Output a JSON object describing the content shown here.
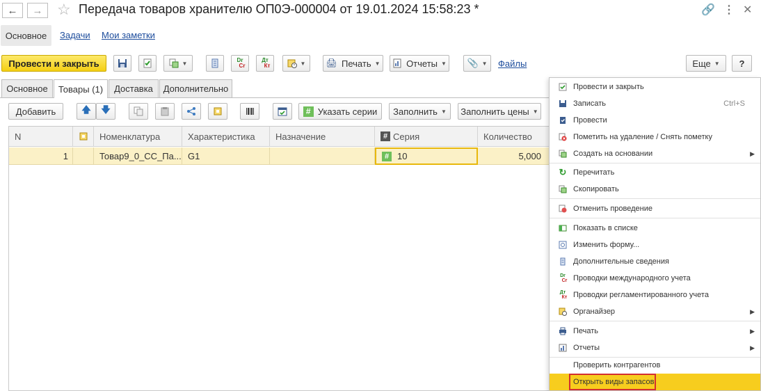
{
  "header": {
    "title": "Передача товаров хранителю ОП0Э-000004 от 19.01.2024 15:58:23 *",
    "back_icon": "arrow-left-icon",
    "forward_icon": "arrow-right-icon"
  },
  "subnav": {
    "main": "Основное",
    "tasks": "Задачи",
    "notes": "Мои заметки"
  },
  "toolbar": {
    "post_close": "Провести и закрыть",
    "print": "Печать",
    "reports": "Отчеты",
    "files": "Файлы",
    "more": "Еще",
    "help": "?",
    "dr_top": "Dr",
    "dr_bot": "Cr",
    "dt_top": "Дт",
    "dt_bot": "Кт"
  },
  "tabs": [
    {
      "label": "Основное"
    },
    {
      "label": "Товары (1)"
    },
    {
      "label": "Доставка"
    },
    {
      "label": "Дополнительно"
    }
  ],
  "table_toolbar": {
    "add": "Добавить",
    "series": "Указать серии",
    "fill": "Заполнить",
    "fill_prices": "Заполнить цены",
    "series_icon_glyph": "#"
  },
  "table": {
    "headers": {
      "n": "N",
      "nomenclature": "Номенклатура",
      "characteristic": "Характеристика",
      "purpose": "Назначение",
      "series": "Серия",
      "quantity": "Количество"
    },
    "rows": [
      {
        "n": "1",
        "nomenclature": "Товар9_0_СС_Па...",
        "characteristic": "G1",
        "purpose": "",
        "series": "10",
        "quantity": "5,000"
      }
    ]
  },
  "menu": {
    "items": [
      {
        "label": "Провести и закрыть"
      },
      {
        "label": "Записать",
        "shortcut": "Ctrl+S"
      },
      {
        "label": "Провести"
      },
      {
        "label": "Пометить на удаление / Снять пометку"
      },
      {
        "label": "Создать на основании"
      },
      {
        "label": "Перечитать"
      },
      {
        "label": "Скопировать"
      },
      {
        "label": "Отменить проведение"
      },
      {
        "label": "Показать в списке"
      },
      {
        "label": "Изменить форму..."
      },
      {
        "label": "Дополнительные сведения"
      },
      {
        "label": "Проводки международного учета"
      },
      {
        "label": "Проводки регламентированного учета"
      },
      {
        "label": "Органайзер"
      },
      {
        "label": "Печать"
      },
      {
        "label": "Отчеты"
      },
      {
        "label": "Проверить контрагентов"
      },
      {
        "label": "Открыть виды запасов"
      }
    ]
  },
  "colors": {
    "accent_yellow": "#f4cf14",
    "highlight": "#f7cd1e",
    "link": "#1c4c9c",
    "row_selected": "#fbf1c7",
    "red_box": "#d32f2f"
  }
}
